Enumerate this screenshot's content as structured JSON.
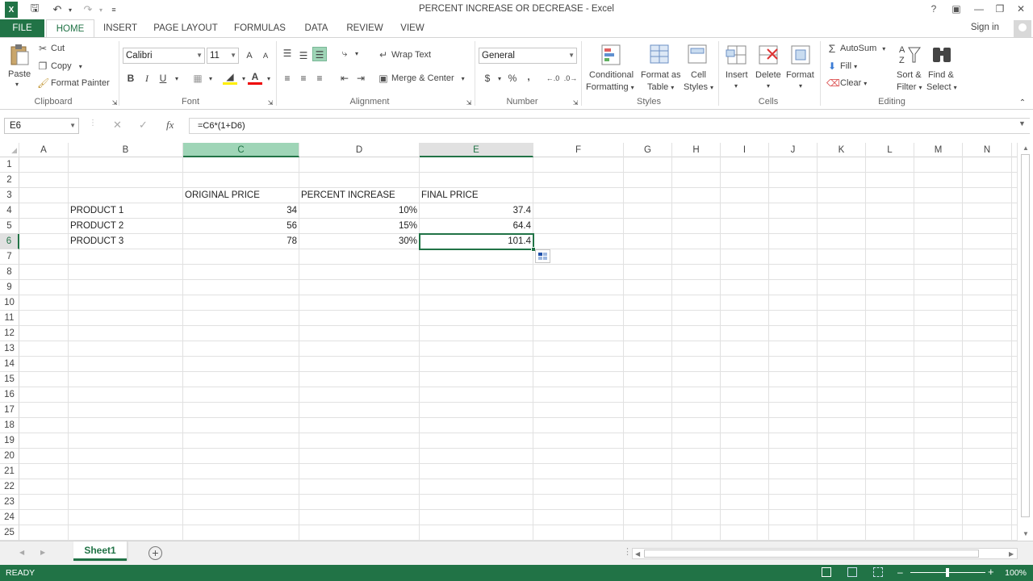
{
  "window": {
    "title": "PERCENT INCREASE OR DECREASE - Excel"
  },
  "tabs": [
    "FILE",
    "HOME",
    "INSERT",
    "PAGE LAYOUT",
    "FORMULAS",
    "DATA",
    "REVIEW",
    "VIEW"
  ],
  "account": {
    "signin": "Sign in"
  },
  "ribbon": {
    "clipboard": {
      "label": "Clipboard",
      "paste": "Paste",
      "cut": "Cut",
      "copy": "Copy",
      "format_painter": "Format Painter"
    },
    "font": {
      "label": "Font",
      "name": "Calibri",
      "size": "11",
      "bold": "B",
      "italic": "I",
      "underline": "U",
      "grow": "A",
      "shrink": "A"
    },
    "alignment": {
      "label": "Alignment",
      "wrap_text": "Wrap Text",
      "merge_center": "Merge & Center"
    },
    "number": {
      "label": "Number",
      "format": "General",
      "currency": "$",
      "percent": "%",
      "comma": ","
    },
    "styles": {
      "label": "Styles",
      "conditional_1": "Conditional",
      "conditional_2": "Formatting",
      "format_table_1": "Format as",
      "format_table_2": "Table",
      "cell_styles_1": "Cell",
      "cell_styles_2": "Styles"
    },
    "cells": {
      "label": "Cells",
      "insert": "Insert",
      "delete": "Delete",
      "format": "Format"
    },
    "editing": {
      "label": "Editing",
      "autosum": "AutoSum",
      "fill": "Fill",
      "clear": "Clear",
      "sort_1": "Sort &",
      "sort_2": "Filter",
      "find_1": "Find &",
      "find_2": "Select"
    }
  },
  "formula_bar": {
    "name_box": "E6",
    "formula": "=C6*(1+D6)"
  },
  "columns": [
    "A",
    "B",
    "C",
    "D",
    "E",
    "F",
    "G",
    "H",
    "I",
    "J",
    "K",
    "L",
    "M",
    "N"
  ],
  "rows": [
    "1",
    "2",
    "3",
    "4",
    "5",
    "6",
    "7",
    "8",
    "9",
    "10",
    "11",
    "12",
    "13",
    "14",
    "15",
    "16",
    "17",
    "18",
    "19",
    "20",
    "21",
    "22",
    "23",
    "24",
    "25"
  ],
  "cells": {
    "C3": "ORIGINAL PRICE",
    "D3": "PERCENT INCREASE",
    "E3": "FINAL PRICE",
    "B4": "PRODUCT 1",
    "C4": "34",
    "D4": "10%",
    "E4": "37.4",
    "B5": "PRODUCT 2",
    "C5": "56",
    "D5": "15%",
    "E5": "64.4",
    "B6": "PRODUCT 3",
    "C6": "78",
    "D6": "30%",
    "E6": "101.4"
  },
  "sheets": [
    "Sheet1"
  ],
  "status": {
    "mode": "READY",
    "zoom": "100%"
  },
  "colors": {
    "accent": "#217346",
    "selected_header": "#9fd5b7"
  }
}
